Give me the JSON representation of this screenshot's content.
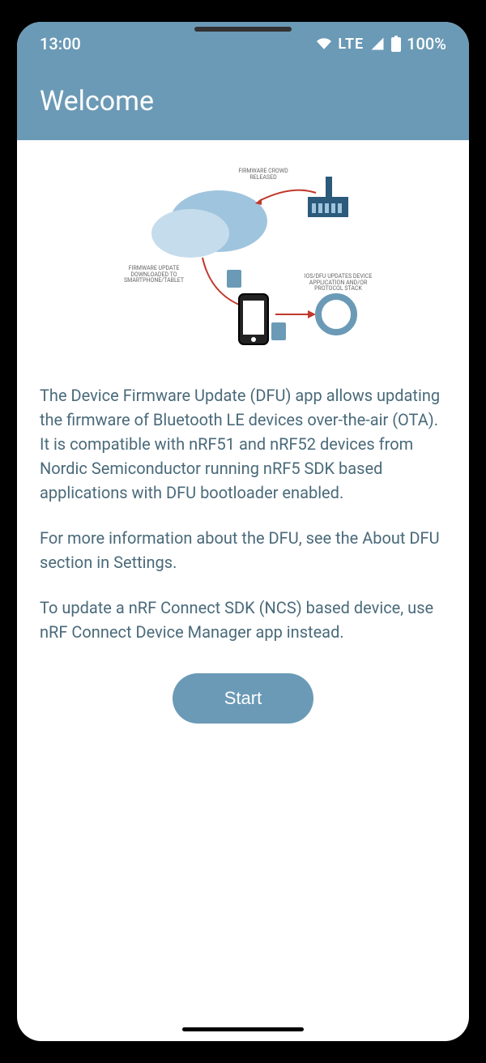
{
  "status_bar": {
    "time": "13:00",
    "network": "LTE",
    "battery": "100%"
  },
  "app_bar": {
    "title": "Welcome"
  },
  "diagram": {
    "label_top": "FIRMWARE CROWD RELEASED",
    "label_left": "FIRMWARE UPDATE DOWNLOADED TO SMARTPHONE/TABLET",
    "label_right": "IOS/DFU UPDATES DEVICE APPLICATION AND/OR PROTOCOL STACK"
  },
  "content": {
    "paragraph1": "The Device Firmware Update (DFU) app allows updating the firmware of Bluetooth LE devices over-the-air (OTA). It is compatible with nRF51 and nRF52 devices from Nordic Semiconductor running nRF5 SDK based applications with DFU bootloader enabled.",
    "paragraph2": "For more information about the DFU, see the About DFU section in Settings.",
    "paragraph3": "To update a nRF Connect SDK (NCS) based device, use nRF Connect Device Manager app instead.",
    "start_button": "Start"
  }
}
